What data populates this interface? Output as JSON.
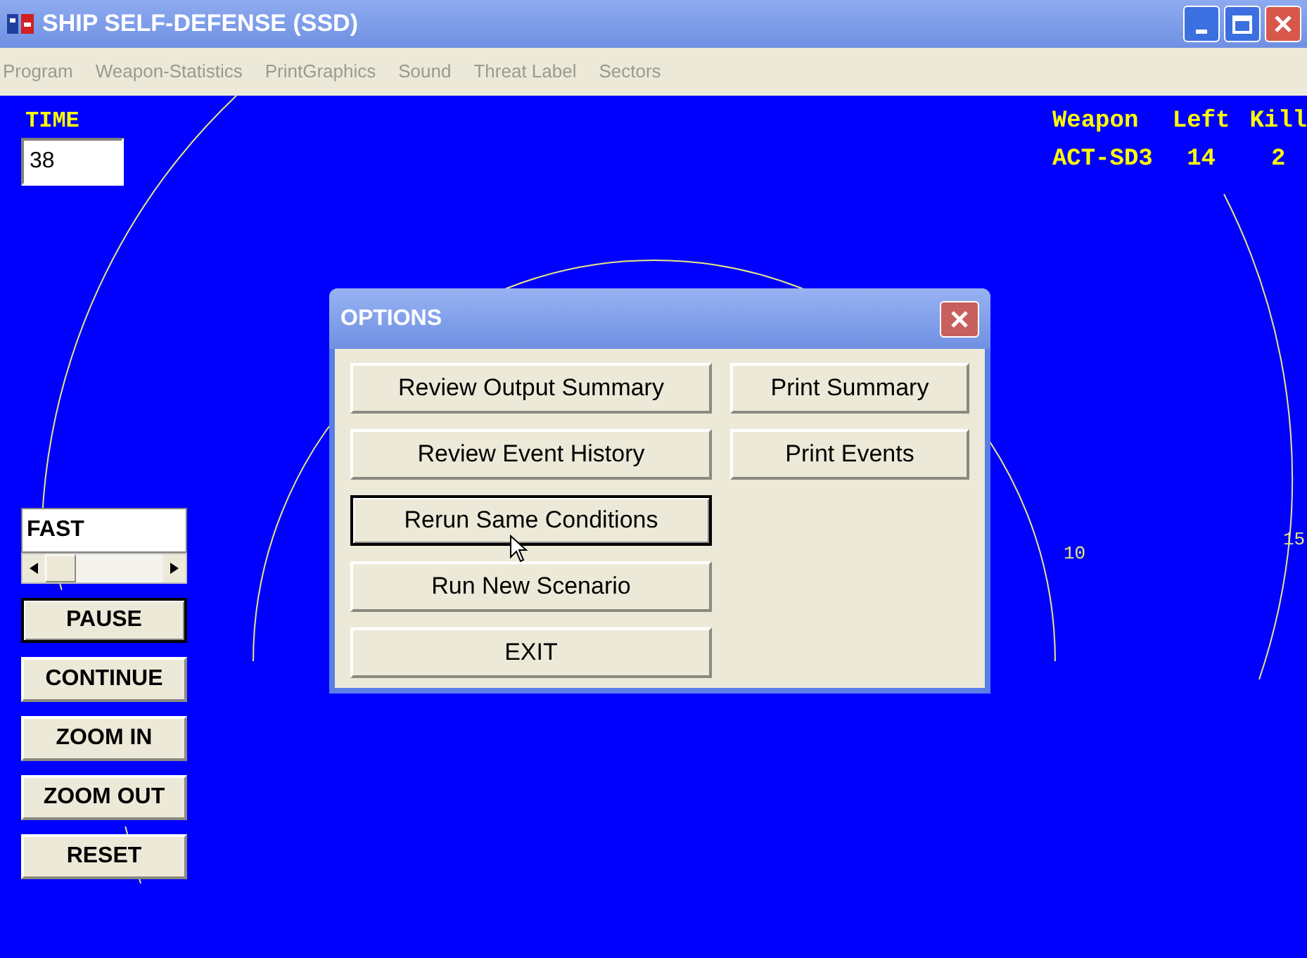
{
  "window": {
    "title": "SHIP SELF-DEFENSE (SSD)"
  },
  "menu": [
    {
      "label": "Program",
      "disabled": true
    },
    {
      "label": "Weapon-Statistics",
      "disabled": true
    },
    {
      "label": "PrintGraphics",
      "disabled": true
    },
    {
      "label": "Sound",
      "disabled": true
    },
    {
      "label": "Threat Label",
      "disabled": true
    },
    {
      "label": "Sectors",
      "disabled": true
    }
  ],
  "time": {
    "label": "TIME",
    "value": "38"
  },
  "weapons": {
    "columns": [
      "Weapon",
      "Left",
      "Kill"
    ],
    "rows": [
      [
        "ACT-SD3",
        "14",
        "2"
      ]
    ]
  },
  "range_labels": [
    "10",
    "15"
  ],
  "speed": {
    "value": "FAST"
  },
  "controls": [
    {
      "label": "PAUSE",
      "focused": true
    },
    {
      "label": "CONTINUE",
      "focused": false
    },
    {
      "label": "ZOOM IN",
      "focused": false
    },
    {
      "label": "ZOOM OUT",
      "focused": false
    },
    {
      "label": "RESET",
      "focused": false
    }
  ],
  "dialog": {
    "title": "OPTIONS",
    "left_buttons": [
      {
        "label": "Review Output Summary",
        "focused": false
      },
      {
        "label": "Review Event History",
        "focused": false
      },
      {
        "label": "Rerun Same Conditions",
        "focused": true
      },
      {
        "label": "Run New Scenario",
        "focused": false
      },
      {
        "label": "EXIT",
        "focused": false
      }
    ],
    "right_buttons": [
      {
        "label": "Print Summary",
        "focused": false
      },
      {
        "label": "Print Events",
        "focused": false
      }
    ]
  }
}
